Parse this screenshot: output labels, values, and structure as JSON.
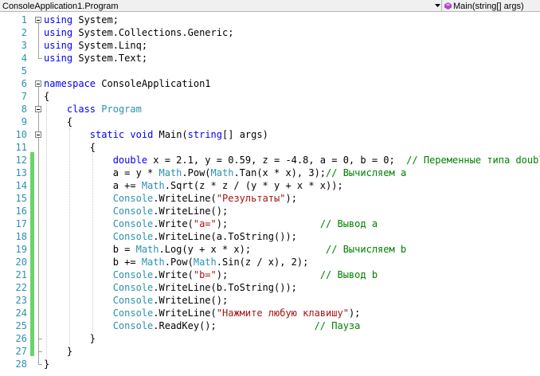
{
  "navbar": {
    "class_selector": "ConsoleApplication1.Program",
    "member_selector": "Main(string[] args)"
  },
  "lines": [
    {
      "num": "1",
      "tokens": [
        {
          "t": "using",
          "c": "kw"
        },
        {
          "t": " System;",
          "c": ""
        }
      ]
    },
    {
      "num": "2",
      "tokens": [
        {
          "t": "using",
          "c": "kw"
        },
        {
          "t": " System.Collections.Generic;",
          "c": ""
        }
      ]
    },
    {
      "num": "3",
      "tokens": [
        {
          "t": "using",
          "c": "kw"
        },
        {
          "t": " System.Linq;",
          "c": ""
        }
      ]
    },
    {
      "num": "4",
      "tokens": [
        {
          "t": "using",
          "c": "kw"
        },
        {
          "t": " System.Text;",
          "c": ""
        }
      ]
    },
    {
      "num": "5",
      "tokens": []
    },
    {
      "num": "6",
      "tokens": [
        {
          "t": "namespace",
          "c": "kw"
        },
        {
          "t": " ConsoleApplication1",
          "c": ""
        }
      ]
    },
    {
      "num": "7",
      "tokens": [
        {
          "t": "{",
          "c": ""
        }
      ]
    },
    {
      "num": "8",
      "tokens": [
        {
          "t": "    ",
          "c": ""
        },
        {
          "t": "class",
          "c": "kw"
        },
        {
          "t": " ",
          "c": ""
        },
        {
          "t": "Program",
          "c": "ty"
        }
      ]
    },
    {
      "num": "9",
      "tokens": [
        {
          "t": "    {",
          "c": ""
        }
      ]
    },
    {
      "num": "10",
      "tokens": [
        {
          "t": "        ",
          "c": ""
        },
        {
          "t": "static",
          "c": "kw"
        },
        {
          "t": " ",
          "c": ""
        },
        {
          "t": "void",
          "c": "kw"
        },
        {
          "t": " Main(",
          "c": ""
        },
        {
          "t": "string",
          "c": "kw"
        },
        {
          "t": "[] args)",
          "c": ""
        }
      ]
    },
    {
      "num": "11",
      "tokens": [
        {
          "t": "        {",
          "c": ""
        }
      ]
    },
    {
      "num": "12",
      "tokens": [
        {
          "t": "            ",
          "c": ""
        },
        {
          "t": "double",
          "c": "kw"
        },
        {
          "t": " x = 2.1, y = 0.59, z = -4.8, a = 0, b = 0;  ",
          "c": ""
        },
        {
          "t": "// Переменные типа double",
          "c": "cm"
        }
      ]
    },
    {
      "num": "13",
      "tokens": [
        {
          "t": "            a = y * ",
          "c": ""
        },
        {
          "t": "Math",
          "c": "ty"
        },
        {
          "t": ".Pow(",
          "c": ""
        },
        {
          "t": "Math",
          "c": "ty"
        },
        {
          "t": ".Tan(x * x), 3);",
          "c": ""
        },
        {
          "t": "// Вычисляем а",
          "c": "cm"
        }
      ]
    },
    {
      "num": "14",
      "tokens": [
        {
          "t": "            a += ",
          "c": ""
        },
        {
          "t": "Math",
          "c": "ty"
        },
        {
          "t": ".Sqrt(z * z / (y * y + x * x));",
          "c": ""
        }
      ]
    },
    {
      "num": "15",
      "tokens": [
        {
          "t": "            ",
          "c": ""
        },
        {
          "t": "Console",
          "c": "ty"
        },
        {
          "t": ".WriteLine(",
          "c": ""
        },
        {
          "t": "\"Результаты\"",
          "c": "str"
        },
        {
          "t": ");",
          "c": ""
        }
      ]
    },
    {
      "num": "16",
      "tokens": [
        {
          "t": "            ",
          "c": ""
        },
        {
          "t": "Console",
          "c": "ty"
        },
        {
          "t": ".WriteLine();",
          "c": ""
        }
      ]
    },
    {
      "num": "17",
      "tokens": [
        {
          "t": "            ",
          "c": ""
        },
        {
          "t": "Console",
          "c": "ty"
        },
        {
          "t": ".Write(",
          "c": ""
        },
        {
          "t": "\"a=\"",
          "c": "str"
        },
        {
          "t": ");                ",
          "c": ""
        },
        {
          "t": "// Вывод а",
          "c": "cm"
        }
      ]
    },
    {
      "num": "18",
      "tokens": [
        {
          "t": "            ",
          "c": ""
        },
        {
          "t": "Console",
          "c": "ty"
        },
        {
          "t": ".WriteLine(a.ToString());",
          "c": ""
        }
      ]
    },
    {
      "num": "19",
      "tokens": [
        {
          "t": "            b = ",
          "c": ""
        },
        {
          "t": "Math",
          "c": "ty"
        },
        {
          "t": ".Log(y + x * x);             ",
          "c": ""
        },
        {
          "t": "// Вычисляем b",
          "c": "cm"
        }
      ]
    },
    {
      "num": "20",
      "tokens": [
        {
          "t": "            b += ",
          "c": ""
        },
        {
          "t": "Math",
          "c": "ty"
        },
        {
          "t": ".Pow(",
          "c": ""
        },
        {
          "t": "Math",
          "c": "ty"
        },
        {
          "t": ".Sin(z / x), 2);",
          "c": ""
        }
      ]
    },
    {
      "num": "21",
      "tokens": [
        {
          "t": "            ",
          "c": ""
        },
        {
          "t": "Console",
          "c": "ty"
        },
        {
          "t": ".Write(",
          "c": ""
        },
        {
          "t": "\"b=\"",
          "c": "str"
        },
        {
          "t": ");                ",
          "c": ""
        },
        {
          "t": "// Вывод b",
          "c": "cm"
        }
      ]
    },
    {
      "num": "22",
      "tokens": [
        {
          "t": "            ",
          "c": ""
        },
        {
          "t": "Console",
          "c": "ty"
        },
        {
          "t": ".WriteLine(b.ToString());",
          "c": ""
        }
      ]
    },
    {
      "num": "23",
      "tokens": [
        {
          "t": "            ",
          "c": ""
        },
        {
          "t": "Console",
          "c": "ty"
        },
        {
          "t": ".WriteLine();",
          "c": ""
        }
      ]
    },
    {
      "num": "24",
      "tokens": [
        {
          "t": "            ",
          "c": ""
        },
        {
          "t": "Console",
          "c": "ty"
        },
        {
          "t": ".WriteLine(",
          "c": ""
        },
        {
          "t": "\"Нажмите любую клавишу\"",
          "c": "str"
        },
        {
          "t": ");",
          "c": ""
        }
      ]
    },
    {
      "num": "25",
      "tokens": [
        {
          "t": "            ",
          "c": ""
        },
        {
          "t": "Console",
          "c": "ty"
        },
        {
          "t": ".ReadKey();                 ",
          "c": ""
        },
        {
          "t": "// Пауза",
          "c": "cm"
        }
      ]
    },
    {
      "num": "26",
      "tokens": [
        {
          "t": "        }",
          "c": ""
        }
      ]
    },
    {
      "num": "27",
      "tokens": [
        {
          "t": "    }",
          "c": ""
        }
      ]
    },
    {
      "num": "28",
      "tokens": [
        {
          "t": "}",
          "c": ""
        }
      ]
    }
  ],
  "colors": {
    "keyword": "#0000ff",
    "type": "#2b91af",
    "string": "#a31515",
    "comment": "#008000",
    "line_number": "#2b91af",
    "changed_line_marker": "#6ad36a"
  }
}
